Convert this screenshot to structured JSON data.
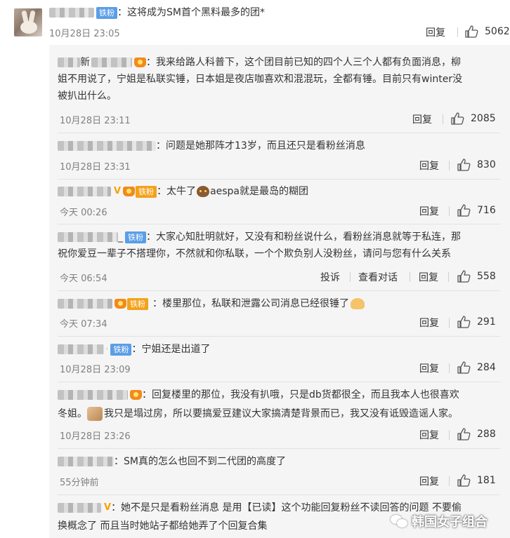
{
  "main": {
    "badge": "铁粉",
    "text": "：这将成为SM首个黑料最多的团*",
    "time": "10月28日 23:05",
    "reply_label": "回复",
    "likes": "5062"
  },
  "actions": {
    "reply": "回复",
    "report": "投诉",
    "view_dialog": "查看对话"
  },
  "replies": [
    {
      "name": "新",
      "line1": "：我来给路人科普下，这个团目前已知的四个人三个人都有负面消息，柳",
      "line2": "姐不用说了，宁姐是私联实锤，日本姐是夜店咖喜欢和混混玩，全都有锤。目前只有winter没",
      "line3": "被扒出什么。",
      "time": "10月28日 23:11",
      "likes": "2085"
    },
    {
      "line1": "：问题是她那阵才13岁，而且还只是看粉丝消息",
      "time": "10月28日 23:31",
      "likes": "830"
    },
    {
      "badge": "铁粉",
      "line1_a": "：太牛了",
      "line1_b": "aespa就是最岛的糊团",
      "time": "今天 00:26",
      "likes": "716"
    },
    {
      "name_suffix": "_",
      "badge": "铁粉",
      "line1": "：大家心知肚明就好，又没有和粉丝说什么，看粉丝消息就等于私连，那",
      "line2": "祝你爱豆一辈子不搭理你，不然就和你私联，一个个欺负别人没粉丝，请问与您有什么关系",
      "time": "今天 06:54",
      "likes": "558"
    },
    {
      "badge": "铁粉",
      "line1": "：楼里那位，私联和泄露公司消息已经很锤了",
      "time": "今天 07:34",
      "likes": "291"
    },
    {
      "badge": "铁粉",
      "line1": "：宁姐还是出道了",
      "time": "10月28日 23:09",
      "likes": "284"
    },
    {
      "line1": "：回复楼里的那位，我没有扒哦，只是db货都很全，而且我本人也很喜欢",
      "line2_a": "冬姐。",
      "line2_b": "我只是塌过房，所以要搞爱豆建议大家搞清楚背景而已，我又没有诋毁造谣人家。",
      "time": "10月28日 23:26",
      "likes": "288"
    },
    {
      "line1": "：SM真的怎么也回不到二代团的高度了",
      "time": "55分钟前",
      "likes": "181"
    },
    {
      "line1": "：她不是只是看粉丝消息 是用【已读】这个功能回复粉丝不读回答的问题 不要偷",
      "line2": "换概念了 而且当时她站子都给她弄了个回复合集"
    }
  ],
  "watermark": "韩国女子组合",
  "colors": {
    "badge_blue": "#5a9ee6",
    "badge_gold": "#f3a21c",
    "reply_bg": "#f5f5f5",
    "meta_gray": "#808080"
  }
}
